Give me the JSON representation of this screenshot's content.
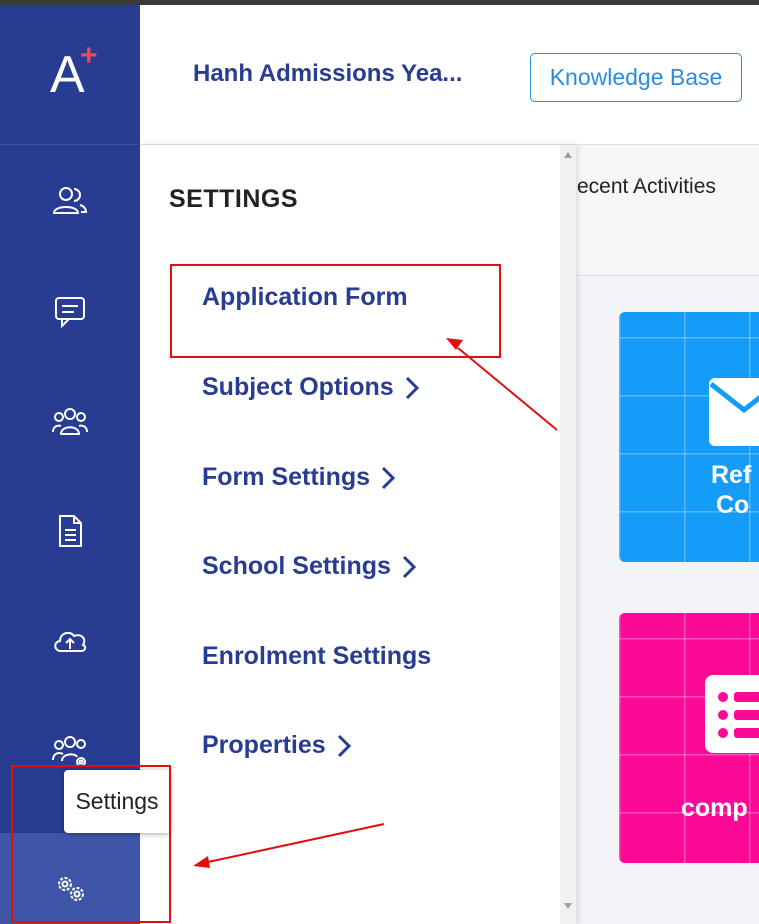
{
  "app": {
    "logo_letter": "A",
    "logo_plus": "+"
  },
  "header": {
    "title": "Hanh Admissions Yea...",
    "knowledge_base_label": "Knowledge Base"
  },
  "sidebar": {
    "items": [
      {
        "icon": "contacts-icon"
      },
      {
        "icon": "message-icon"
      },
      {
        "icon": "groups-icon"
      },
      {
        "icon": "document-icon"
      },
      {
        "icon": "cloud-upload-icon"
      },
      {
        "icon": "users-settings-icon"
      },
      {
        "icon": "settings-gear-icon",
        "tooltip": "Settings"
      }
    ]
  },
  "settings_panel": {
    "title": "SETTINGS",
    "items": [
      {
        "label": "Application Form",
        "has_submenu": false
      },
      {
        "label": "Subject Options",
        "has_submenu": true
      },
      {
        "label": "Form Settings",
        "has_submenu": true
      },
      {
        "label": "School Settings",
        "has_submenu": true
      },
      {
        "label": "Enrolment Settings",
        "has_submenu": false
      },
      {
        "label": "Properties",
        "has_submenu": true
      }
    ]
  },
  "background": {
    "recent_activities": "ecent Activities",
    "card_blue_caption": [
      "Ref",
      "Co"
    ],
    "card_pink_caption": "comp"
  },
  "colors": {
    "sidebar": "#283d91",
    "accent_text": "#283d91",
    "link_blue": "#2a8de0",
    "card_blue": "#149cf8",
    "card_pink": "#fa0a97",
    "annotation_red": "#e01010"
  }
}
